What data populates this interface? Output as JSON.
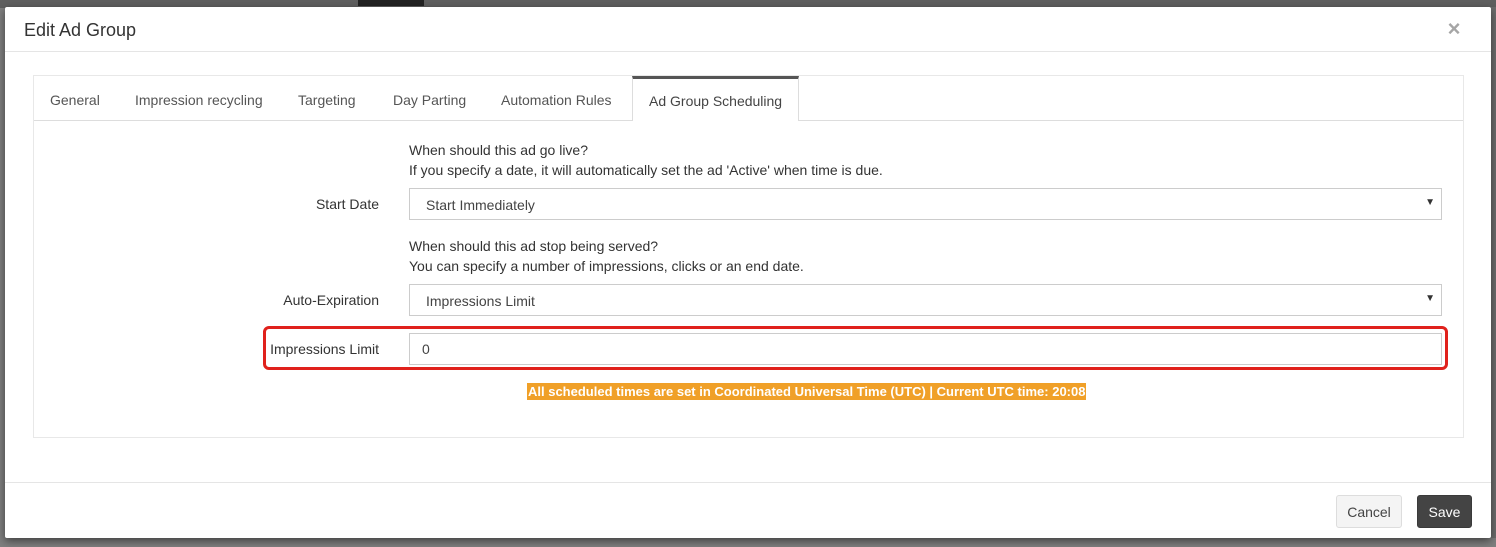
{
  "modal": {
    "title": "Edit Ad Group",
    "close_label": "×"
  },
  "tabs": [
    {
      "label": "General",
      "active": false
    },
    {
      "label": "Impression recycling",
      "active": false
    },
    {
      "label": "Targeting",
      "active": false
    },
    {
      "label": "Day Parting",
      "active": false
    },
    {
      "label": "Automation Rules",
      "active": false
    },
    {
      "label": "Ad Group Scheduling",
      "active": true
    }
  ],
  "start_date": {
    "help_line1": "When should this ad go live?",
    "help_line2": "If you specify a date, it will automatically set the ad 'Active' when time is due.",
    "label": "Start Date",
    "value": "Start Immediately"
  },
  "auto_expiration": {
    "help_line1": "When should this ad stop being served?",
    "help_line2": "You can specify a number of impressions, clicks or an end date.",
    "label": "Auto-Expiration",
    "value": "Impressions Limit"
  },
  "impressions_limit": {
    "label": "Impressions Limit",
    "value": "0"
  },
  "utc_note": "All scheduled times are set in Coordinated Universal Time (UTC) | Current UTC time: 20:08",
  "footer": {
    "cancel_label": "Cancel",
    "save_label": "Save"
  },
  "colors": {
    "highlight": "#e0211c",
    "utc_note_bg": "#f0a028",
    "save_button_bg": "#444444"
  },
  "icons": {
    "close": "close-icon",
    "caret": "caret-down-icon"
  }
}
